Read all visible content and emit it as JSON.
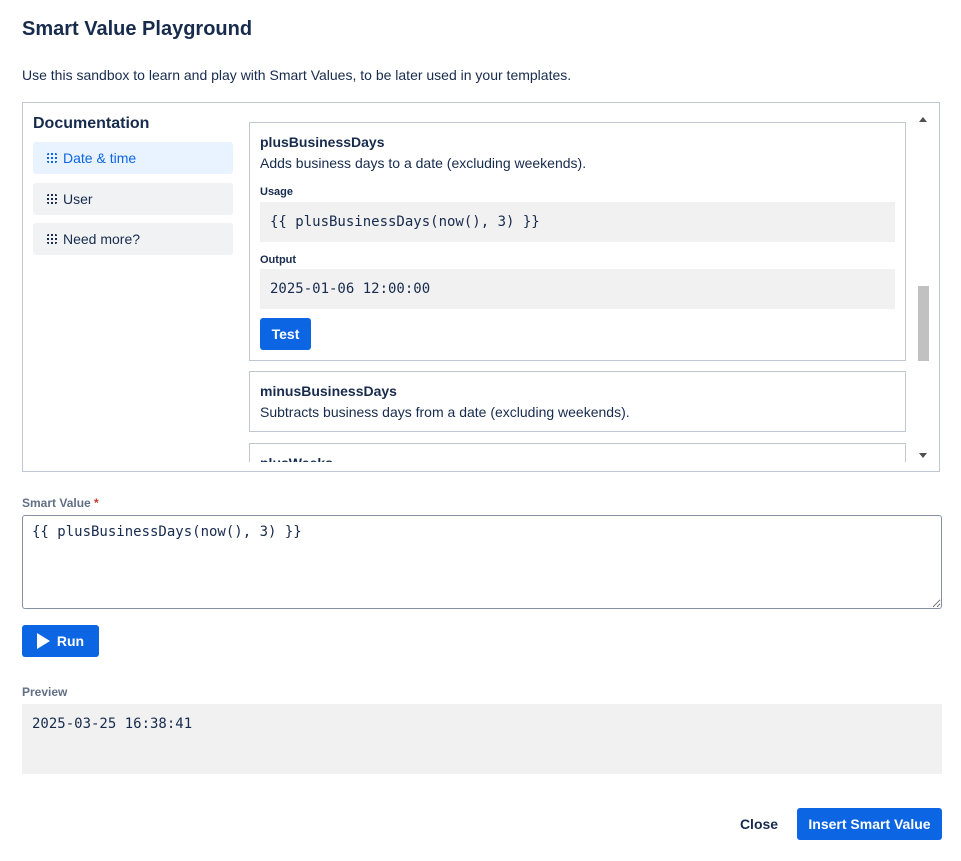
{
  "dialog": {
    "title": "Smart Value Playground",
    "subtitle": "Use this sandbox to learn and play with Smart Values, to be later used in your templates."
  },
  "documentation": {
    "heading": "Documentation",
    "nav_items": [
      {
        "label": "Date & time",
        "active": true
      },
      {
        "label": "User",
        "active": false
      },
      {
        "label": "Need more?",
        "active": false
      }
    ],
    "functions": [
      {
        "name": "plusBusinessDays",
        "description": "Adds business days to a date (excluding weekends).",
        "usage_label": "Usage",
        "usage": "{{ plusBusinessDays(now(), 3) }}",
        "output_label": "Output",
        "output": "2025-01-06 12:00:00",
        "test_label": "Test"
      },
      {
        "name": "minusBusinessDays",
        "description": "Subtracts business days from a date (excluding weekends)."
      },
      {
        "name": "plusWeeks"
      }
    ]
  },
  "smart_value": {
    "label": "Smart Value",
    "required_mark": "*",
    "value": "{{ plusBusinessDays(now(), 3) }}"
  },
  "run_label": "Run",
  "preview": {
    "label": "Preview",
    "value": "2025-03-25 16:38:41"
  },
  "footer": {
    "close_label": "Close",
    "insert_label": "Insert Smart Value"
  },
  "colors": {
    "primary": "#0c66e4",
    "active_nav_bg": "#e9f2ff",
    "required": "#c9372c"
  },
  "icons": {
    "nav": "focus-icon",
    "run": "play-icon"
  }
}
